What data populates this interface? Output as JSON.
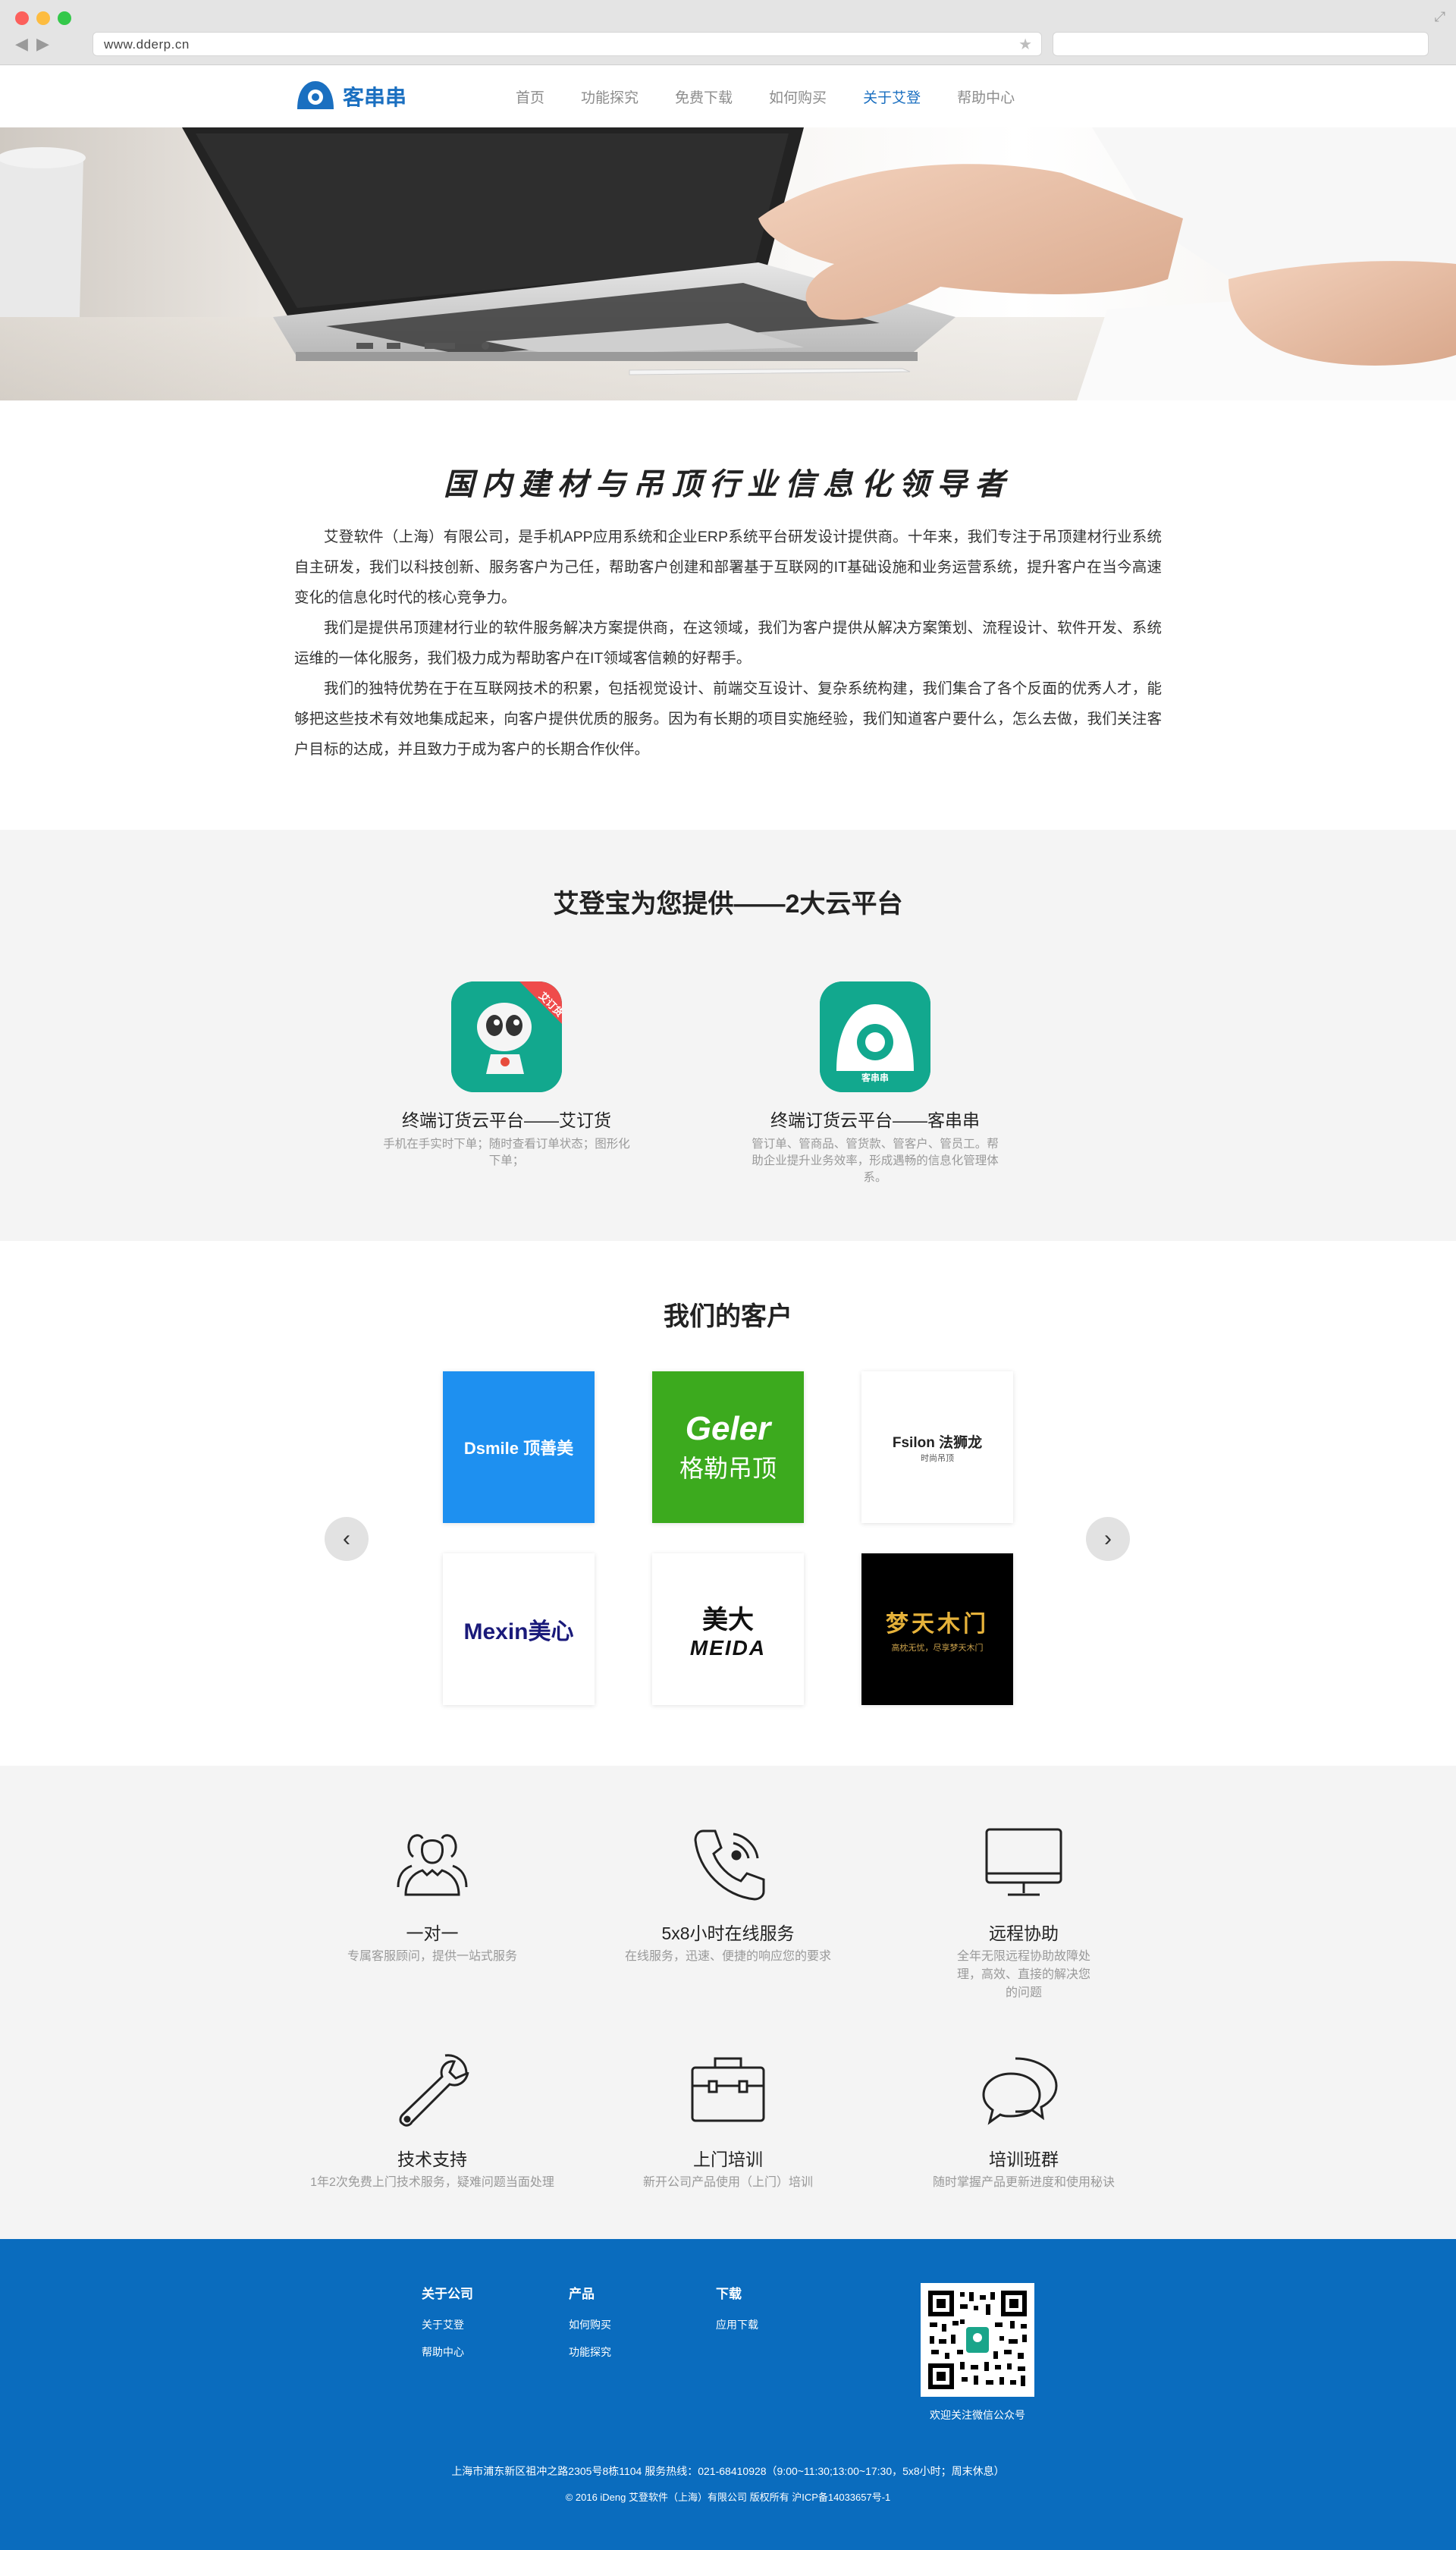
{
  "browser": {
    "url": "www.dderp.cn"
  },
  "site": {
    "logo_text": "客串串",
    "menu": [
      {
        "label": "首页"
      },
      {
        "label": "功能探究"
      },
      {
        "label": "免费下载"
      },
      {
        "label": "如何购买"
      },
      {
        "label": "关于艾登",
        "active": true
      },
      {
        "label": "帮助中心"
      }
    ],
    "accent_color": "#1a6fc0"
  },
  "about": {
    "title": "国内建材与吊顶行业信息化领导者",
    "paragraphs": [
      "艾登软件（上海）有限公司，是手机APP应用系统和企业ERP系统平台研发设计提供商。十年来，我们专注于吊顶建材行业系统自主研发，我们以科技创新、服务客户为己任，帮助客户创建和部署基于互联网的IT基础设施和业务运营系统，提升客户在当今高速变化的信息化时代的核心竞争力。",
      "我们是提供吊顶建材行业的软件服务解决方案提供商，在这领域，我们为客户提供从解决方案策划、流程设计、软件开发、系统运维的一体化服务，我们极力成为帮助客户在IT领域客信赖的好帮手。",
      "我们的独特优势在于在互联网技术的积累，包括视觉设计、前端交互设计、复杂系统构建，我们集合了各个反面的优秀人才，能够把这些技术有效地集成起来，向客户提供优质的服务。因为有长期的项目实施经验，我们知道客户要什么，怎么去做，我们关注客户目标的达成，并且致力于成为客户的长期合作伙伴。"
    ]
  },
  "platforms": {
    "title": "艾登宝为您提供——2大云平台",
    "items": [
      {
        "name": "终端订货云平台——艾订货",
        "desc": "手机在手实时下单；随时查看订单状态；图形化下单；",
        "badge": "艾订货"
      },
      {
        "name": "终端订货云平台——客串串",
        "desc": "管订单、管商品、管货款、管客户、管员工。帮助企业提升业务效率，形成遇畅的信息化管理体系。",
        "badge": "客串串"
      }
    ]
  },
  "customers": {
    "title": "我们的客户",
    "logos": [
      {
        "text": "Dsmile 顶善美",
        "bg": "#1e90f0"
      },
      {
        "text": "Geler",
        "sub": "格勒吊顶",
        "bg": "#3caa1e"
      },
      {
        "text": "Fsilon 法狮龙",
        "sub": "时尚吊顶",
        "bg": "#ffffff"
      },
      {
        "text": "Mexin美心",
        "bg": "#ffffff"
      },
      {
        "text": "美大",
        "sub": "MEIDA",
        "bg": "#ffffff"
      },
      {
        "text": "梦天木门",
        "sub": "高枕无忧，尽享梦天木门",
        "bg": "#000000"
      }
    ],
    "prev": "‹",
    "next": "›"
  },
  "services": [
    {
      "icon": "people-icon",
      "name": "一对一",
      "desc": "专属客服顾问，提供一站式服务"
    },
    {
      "icon": "phone-icon",
      "name": "5x8小时在线服务",
      "desc": "在线服务，迅速、便捷的响应您的要求"
    },
    {
      "icon": "monitor-icon",
      "name": "远程协助",
      "desc": "全年无限远程协助故障处理，高效、直接的解决您的问题"
    },
    {
      "icon": "wrench-icon",
      "name": "技术支持",
      "desc": "1年2次免费上门技术服务，疑难问题当面处理"
    },
    {
      "icon": "briefcase-icon",
      "name": "上门培训",
      "desc": "新开公司产品使用（上门）培训"
    },
    {
      "icon": "chat-icon",
      "name": "培训班群",
      "desc": "随时掌握产品更新进度和使用秘诀"
    }
  ],
  "footer": {
    "cols": [
      {
        "title": "关于公司",
        "links": [
          "关于艾登",
          "帮助中心"
        ]
      },
      {
        "title": "产品",
        "links": [
          "如何购买",
          "功能探究"
        ]
      },
      {
        "title": "下载",
        "links": [
          "应用下载"
        ]
      }
    ],
    "qr_caption": "欢迎关注微信公众号",
    "address": "上海市浦东新区祖冲之路2305号8栋1104 服务热线：021-68410928（9:00~11:30;13:00~17:30，5x8小时；周末休息）",
    "copyright": "© 2016 iDeng 艾登软件（上海）有限公司 版权所有 沪ICP备14033657号-1",
    "bg_color": "#0a6cbe"
  }
}
